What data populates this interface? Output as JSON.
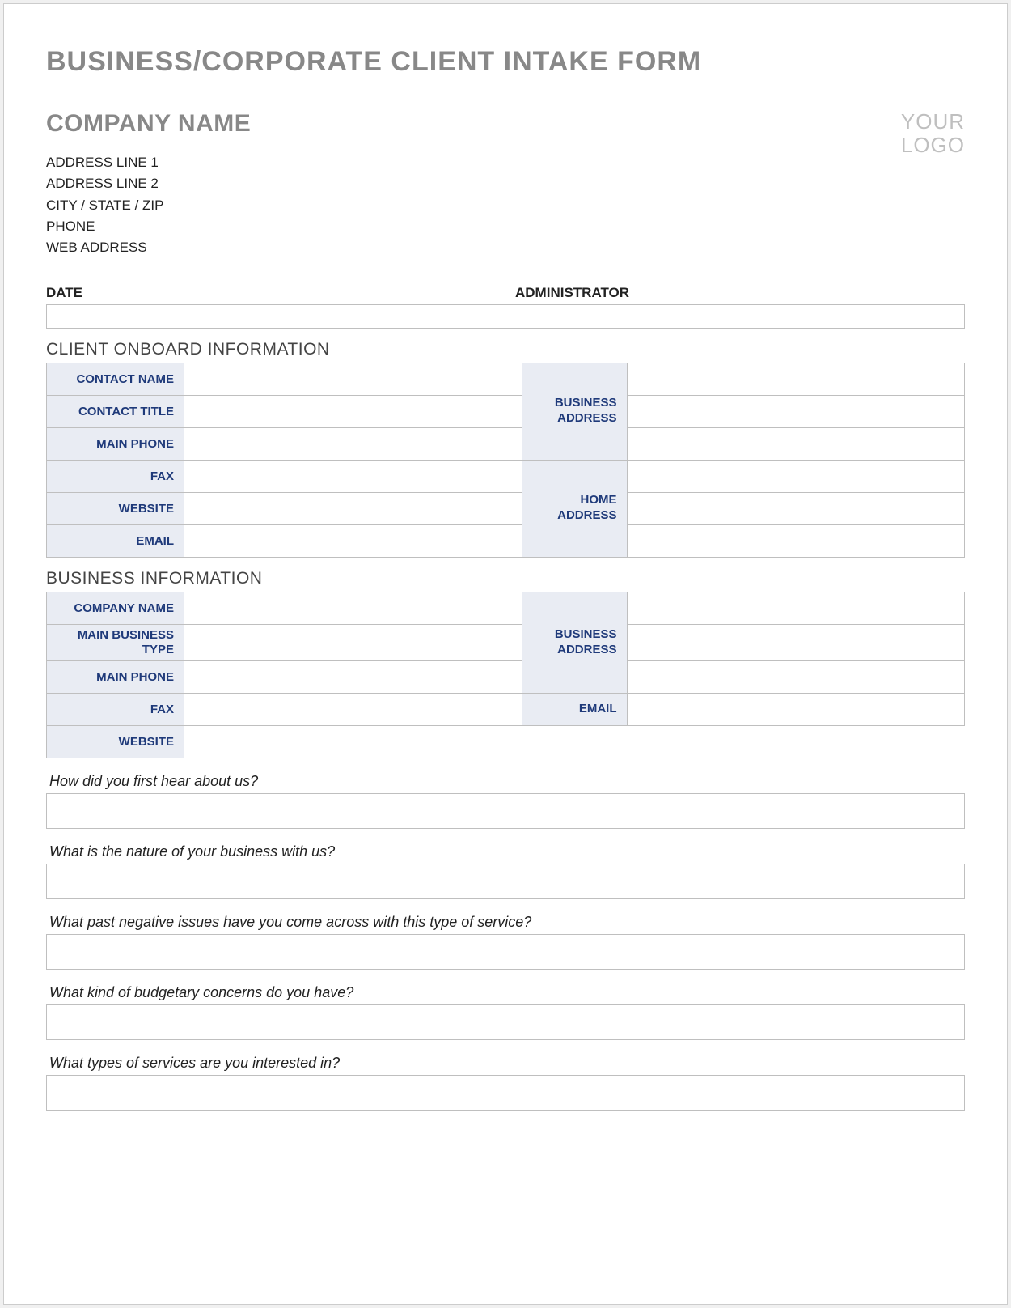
{
  "title": "BUSINESS/CORPORATE CLIENT INTAKE FORM",
  "company": {
    "name_label": "COMPANY NAME",
    "logo_line1": "YOUR",
    "logo_line2": "LOGO",
    "address_line1": "ADDRESS LINE 1",
    "address_line2": "ADDRESS LINE 2",
    "city_state_zip": "CITY / STATE / ZIP",
    "phone_label": "PHONE",
    "web_label": "WEB ADDRESS"
  },
  "meta": {
    "date_label": "DATE",
    "admin_label": "ADMINISTRATOR"
  },
  "section_client": {
    "title": "CLIENT ONBOARD INFORMATION",
    "labels": {
      "contact_name": "CONTACT NAME",
      "contact_title": "CONTACT TITLE",
      "main_phone": "MAIN PHONE",
      "fax": "FAX",
      "website": "WEBSITE",
      "email": "EMAIL",
      "business_address": "BUSINESS ADDRESS",
      "home_address": "HOME ADDRESS"
    }
  },
  "section_business": {
    "title": "BUSINESS INFORMATION",
    "labels": {
      "company_name": "COMPANY NAME",
      "main_business_type": "MAIN BUSINESS TYPE",
      "main_phone": "MAIN PHONE",
      "fax": "FAX",
      "website": "WEBSITE",
      "business_address": "BUSINESS ADDRESS",
      "email": "EMAIL"
    }
  },
  "questions": {
    "q1": "How did you first hear about us?",
    "q2": "What is the nature of your business with us?",
    "q3": "What past negative issues have you come across with this type of service?",
    "q4": "What kind of budgetary concerns do you have?",
    "q5": "What types of services are you interested in?"
  }
}
